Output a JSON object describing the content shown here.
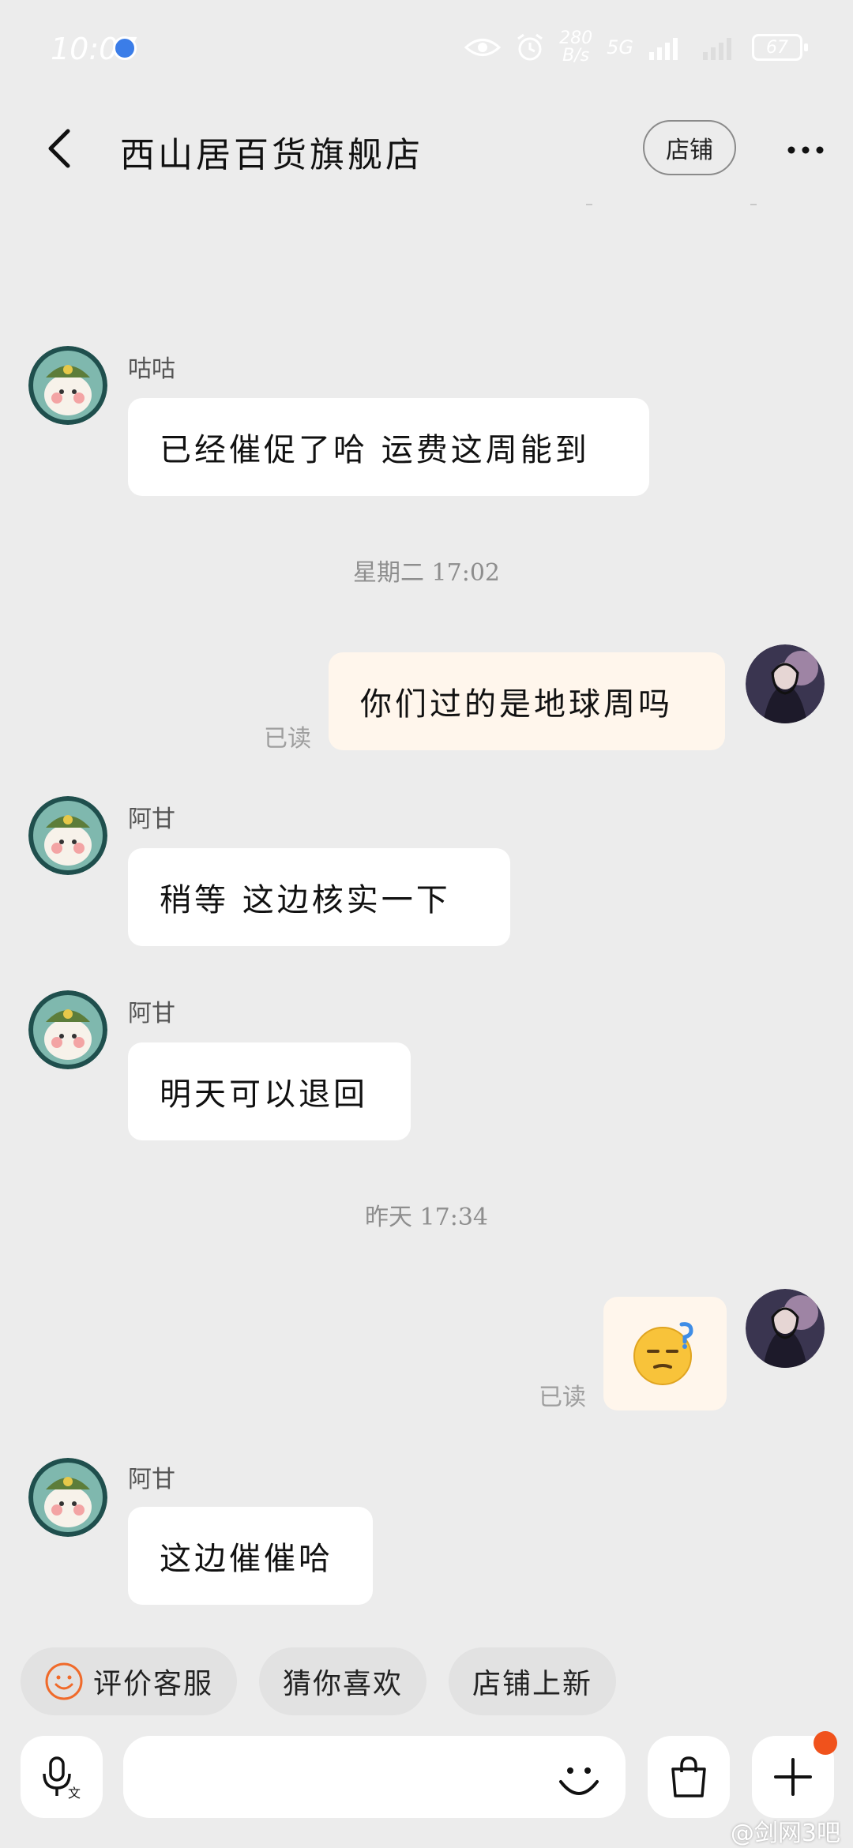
{
  "status_bar": {
    "time": "10:07",
    "net_speed_value": "280",
    "net_speed_unit": "B/s",
    "network": "5G",
    "battery": "67"
  },
  "header": {
    "title": "西山居百货旗舰店",
    "shop_button_label": "店铺"
  },
  "messages": [
    {
      "sender": "咕咕",
      "text": "已经催促了哈 运费这周能到"
    },
    {
      "timestamp": "星期二 17:02"
    },
    {
      "text": "你们过的是地球周吗",
      "read_label": "已读"
    },
    {
      "sender": "阿甘",
      "text": "稍等 这边核实一下"
    },
    {
      "sender": "阿甘",
      "text": "明天可以退回"
    },
    {
      "timestamp": "昨天 17:34"
    },
    {
      "emoji": "confused-face-emoji",
      "read_label": "已读"
    },
    {
      "sender": "阿甘",
      "text": "这边催催哈"
    }
  ],
  "quick_actions": [
    {
      "label": "评价客服",
      "icon": "smiley-icon"
    },
    {
      "label": "猜你喜欢"
    },
    {
      "label": "店铺上新"
    }
  ],
  "input_bar": {
    "placeholder": ""
  },
  "watermark": "@剑网3吧",
  "colors": {
    "background": "#ececec",
    "incoming_bubble": "#ffffff",
    "outgoing_bubble": "#fff6ec",
    "accent": "#f0521c"
  }
}
